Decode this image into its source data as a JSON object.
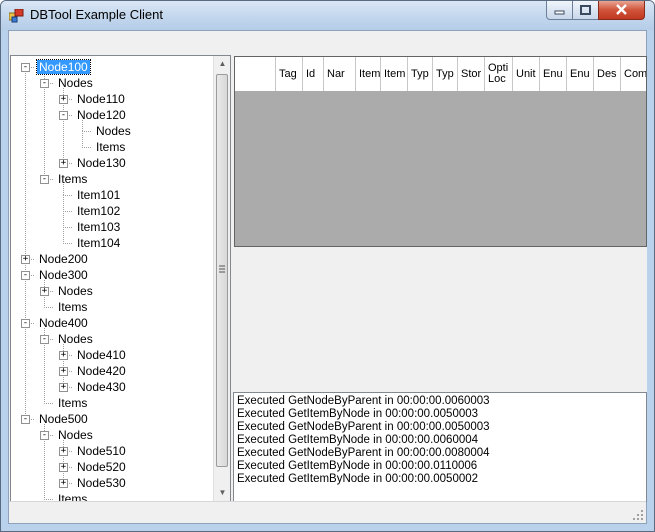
{
  "window": {
    "title": "DBTool Example Client",
    "minimize_glyph": "–",
    "maximize_glyph": "□",
    "close_glyph": "✕"
  },
  "tree": {
    "rows": [
      {
        "label": "Node100",
        "depth": 0,
        "expander": "-",
        "selected": true
      },
      {
        "label": "Nodes",
        "depth": 1,
        "expander": "-"
      },
      {
        "label": "Node110",
        "depth": 2,
        "expander": "+"
      },
      {
        "label": "Node120",
        "depth": 2,
        "expander": "-"
      },
      {
        "label": "Nodes",
        "depth": 3,
        "expander": ""
      },
      {
        "label": "Items",
        "depth": 3,
        "expander": ""
      },
      {
        "label": "Node130",
        "depth": 2,
        "expander": "+"
      },
      {
        "label": "Items",
        "depth": 1,
        "expander": "-"
      },
      {
        "label": "Item101",
        "depth": 2,
        "expander": ""
      },
      {
        "label": "Item102",
        "depth": 2,
        "expander": ""
      },
      {
        "label": "Item103",
        "depth": 2,
        "expander": ""
      },
      {
        "label": "Item104",
        "depth": 2,
        "expander": ""
      },
      {
        "label": "Node200",
        "depth": 0,
        "expander": "+"
      },
      {
        "label": "Node300",
        "depth": 0,
        "expander": "-"
      },
      {
        "label": "Nodes",
        "depth": 1,
        "expander": "+"
      },
      {
        "label": "Items",
        "depth": 1,
        "expander": ""
      },
      {
        "label": "Node400",
        "depth": 0,
        "expander": "-"
      },
      {
        "label": "Nodes",
        "depth": 1,
        "expander": "-"
      },
      {
        "label": "Node410",
        "depth": 2,
        "expander": "+"
      },
      {
        "label": "Node420",
        "depth": 2,
        "expander": "+"
      },
      {
        "label": "Node430",
        "depth": 2,
        "expander": "+"
      },
      {
        "label": "Items",
        "depth": 1,
        "expander": ""
      },
      {
        "label": "Node500",
        "depth": 0,
        "expander": "-"
      },
      {
        "label": "Nodes",
        "depth": 1,
        "expander": "-"
      },
      {
        "label": "Node510",
        "depth": 2,
        "expander": "+"
      },
      {
        "label": "Node520",
        "depth": 2,
        "expander": "+"
      },
      {
        "label": "Node530",
        "depth": 2,
        "expander": "+"
      },
      {
        "label": "Items",
        "depth": 1,
        "expander": ""
      }
    ]
  },
  "grid": {
    "columns": [
      "Tag",
      "Id",
      "Nar",
      "Item",
      "Item",
      "Typ",
      "Typ",
      "Stor",
      "Opti\nLoc",
      "Unit",
      "Enu",
      "Enu",
      "Des",
      "Com"
    ]
  },
  "log": {
    "lines": [
      "Executed GetNodeByParent in 00:00:00.0060003",
      "Executed GetItemByNode in 00:00:00.0050003",
      "Executed GetNodeByParent in 00:00:00.0050003",
      "Executed GetItemByNode in 00:00:00.0060004",
      "Executed GetNodeByParent in 00:00:00.0080004",
      "Executed GetItemByNode in 00:00:00.0110006",
      "Executed GetItemByNode in 00:00:00.0050002"
    ]
  }
}
